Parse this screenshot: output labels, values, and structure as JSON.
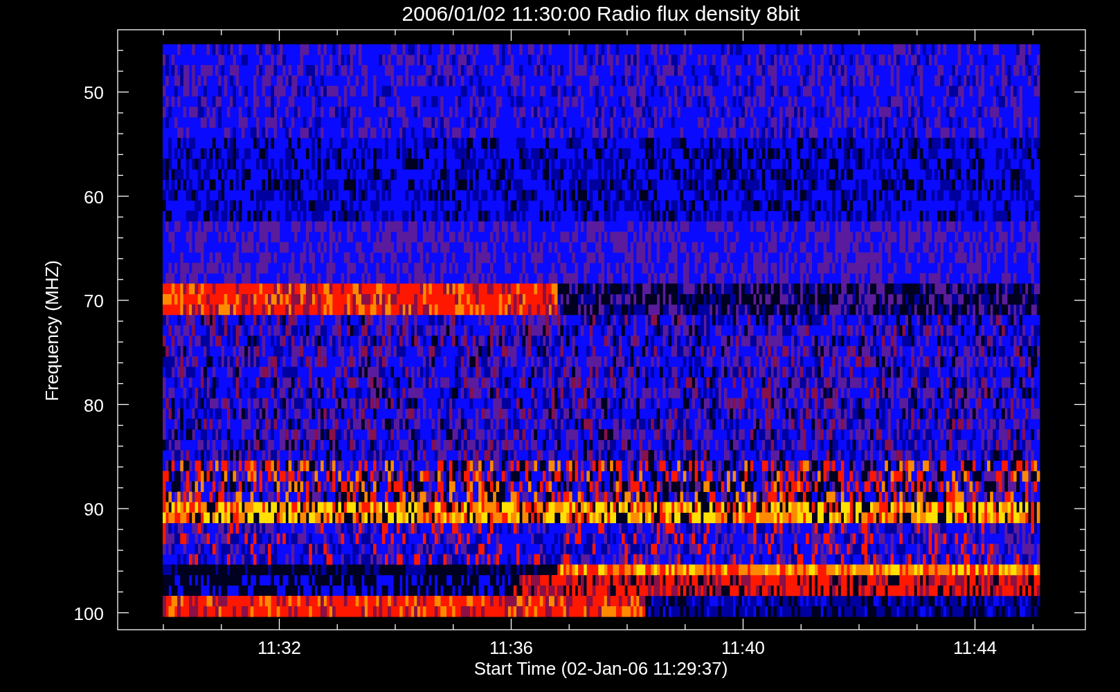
{
  "title": "2006/01/02 11:30:00 Radio flux density 8bit",
  "y_axis": {
    "label": "Frequency (MHZ)",
    "ticks": [
      "50",
      "60",
      "70",
      "80",
      "90",
      "100"
    ]
  },
  "x_axis": {
    "label": "Start Time (02-Jan-06 11:29:37)",
    "ticks": [
      "11:32",
      "11:36",
      "11:40",
      "11:44"
    ]
  }
}
